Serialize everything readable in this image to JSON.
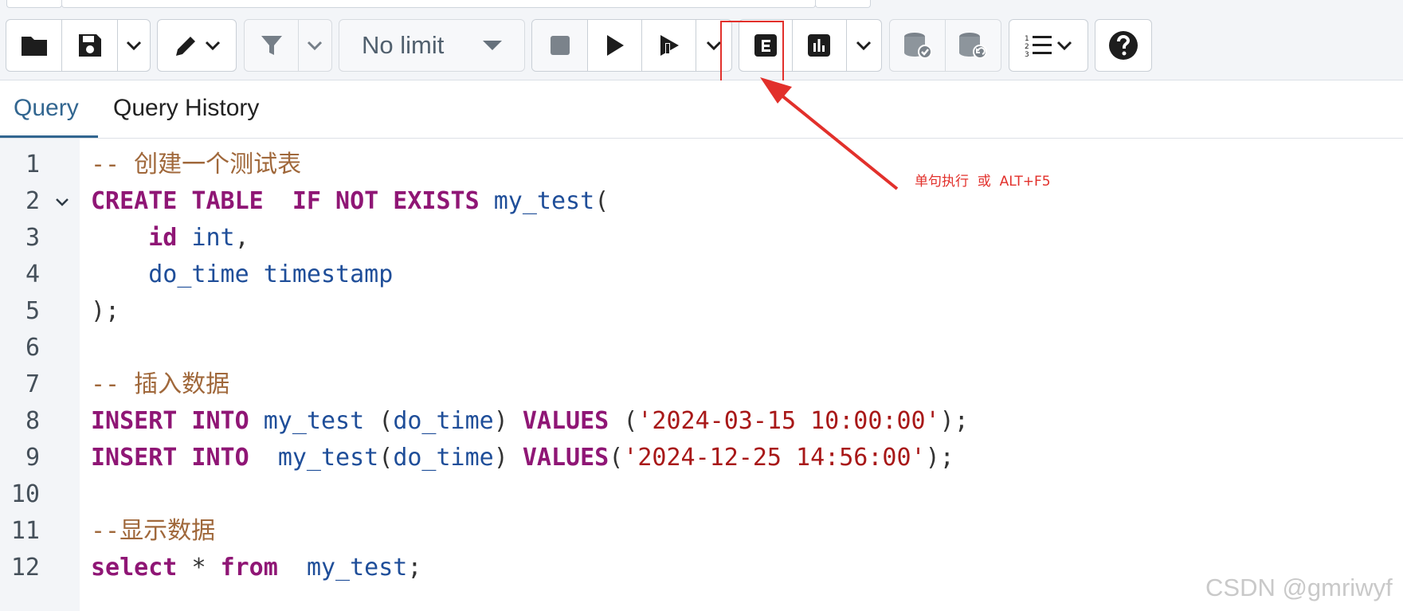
{
  "toolbar": {
    "buttons": [
      {
        "name": "open-file",
        "icon": "folder-icon"
      },
      {
        "name": "save-file",
        "icon": "floppy-disk-icon"
      },
      {
        "name": "save-options",
        "icon": "chevron-down-icon"
      },
      {
        "name": "edit",
        "icon": "pencil-icon"
      },
      {
        "name": "filter",
        "icon": "filter-icon"
      },
      {
        "name": "stop",
        "icon": "stop-icon"
      },
      {
        "name": "execute-script",
        "icon": "play-icon"
      },
      {
        "name": "execute-query",
        "icon": "play-cursor-icon"
      },
      {
        "name": "explain",
        "icon": "explain-e-icon"
      },
      {
        "name": "explain-analyze",
        "icon": "bar-chart-icon"
      },
      {
        "name": "commit",
        "icon": "database-check-icon"
      },
      {
        "name": "rollback",
        "icon": "database-undo-icon"
      },
      {
        "name": "macros",
        "icon": "numbered-list-icon"
      },
      {
        "name": "help",
        "icon": "help-icon"
      }
    ],
    "limit_select": {
      "value": "No limit"
    }
  },
  "tabs": [
    {
      "label": "Query",
      "active": true
    },
    {
      "label": "Query History",
      "active": false
    }
  ],
  "editor": {
    "line_numbers": [
      "1",
      "2",
      "3",
      "4",
      "5",
      "6",
      "7",
      "8",
      "9",
      "10",
      "11",
      "12"
    ],
    "lines": [
      "-- 创建一个测试表",
      "CREATE TABLE  IF NOT EXISTS my_test(",
      "    id int,",
      "    do_time timestamp",
      ");",
      "",
      "-- 插入数据",
      "INSERT INTO my_test (do_time) VALUES ('2024-03-15 10:00:00');",
      "INSERT INTO  my_test(do_time) VALUES('2024-12-25 14:56:00');",
      "",
      "--显示数据",
      "select * from  my_test;"
    ]
  },
  "annotation": {
    "text": "单句执行  或  ALT+F5",
    "color": "#e2302b"
  },
  "watermark": "CSDN @gmriwyf",
  "colors": {
    "keyword": "#8f1675",
    "identifier": "#1f4e99",
    "string": "#a81818",
    "comment": "#a0683b",
    "active_tab": "#326690"
  }
}
